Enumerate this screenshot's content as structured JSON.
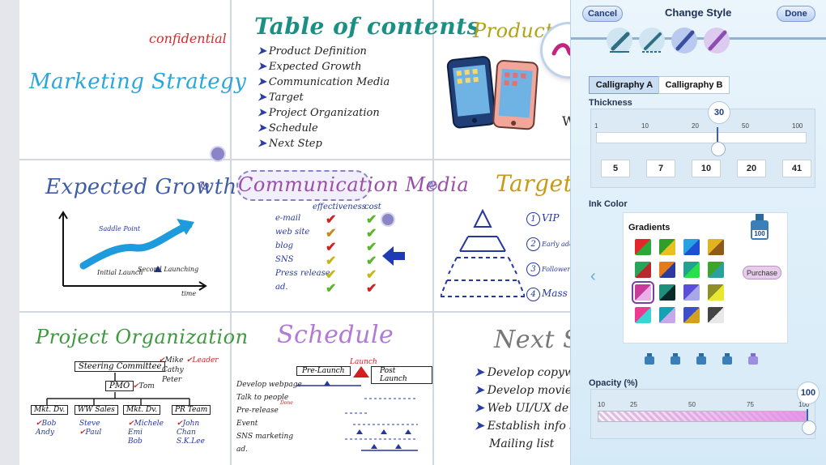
{
  "slides": {
    "marketing": {
      "confidential": "confidential",
      "title": "Marketing Strategy"
    },
    "toc": {
      "title": "Table of contents",
      "items": [
        "Product Definition",
        "Expected Growth",
        "Communication Media",
        "Target",
        "Project Organization",
        "Schedule",
        "Next Step"
      ]
    },
    "product": {
      "title": "Product D",
      "side_letter": "W"
    },
    "growth": {
      "title": "Expected Growth",
      "saddle": "Saddle Point",
      "initial": "Initial Launch",
      "second": "Second Launching",
      "time": "time"
    },
    "comm": {
      "title": "Communication Media",
      "col1": "effectiveness",
      "col2": "cost",
      "rows": [
        "e-mail",
        "web site",
        "blog",
        "SNS",
        "Press release",
        "ad."
      ]
    },
    "target": {
      "title": "Target",
      "items": [
        {
          "num": "1",
          "label": "VIP"
        },
        {
          "num": "2",
          "label": "Early adopter"
        },
        {
          "num": "3",
          "label": "Follower"
        },
        {
          "num": "4",
          "label": "Mass"
        }
      ]
    },
    "project": {
      "title": "Project Organization",
      "steering": "Steering Committee",
      "pmo": "PMO",
      "tom": "Tom",
      "mike": "Mike",
      "cathy": "Cathy",
      "peter": "Peter",
      "leader": "Leader",
      "teams": [
        "Mkt. Dv.",
        "WW Sales",
        "Mkt. Dv.",
        "PR Team"
      ],
      "members": [
        [
          "Bob",
          "Andy"
        ],
        [
          "Steve",
          "Paul"
        ],
        [
          "Michele",
          "Emi",
          "Bob"
        ],
        [
          "John",
          "Chan",
          "S.K.Lee"
        ]
      ]
    },
    "schedule": {
      "title": "Schedule",
      "launch": "Launch",
      "pre": "Pre-Launch",
      "post": "Post Launch",
      "tasks": [
        "Develop webpage",
        "Talk to people",
        "Pre-release",
        "Event",
        "SNS marketing",
        "ad."
      ],
      "note": "Done"
    },
    "next": {
      "title": "Next St",
      "items": [
        "Develop copywri",
        "Develop movie s",
        "Web UI/UX de",
        "Establish info s",
        "Mailing list"
      ]
    }
  },
  "panel": {
    "cancel": "Cancel",
    "title": "Change Style",
    "done": "Done",
    "pen_icons": [
      "pen-1-icon",
      "pen-2-icon",
      "pen-3-icon",
      "brush-icon"
    ],
    "tabs": [
      "Calligraphy A",
      "Calligraphy B"
    ],
    "thickness_label": "Thickness",
    "thickness_value": "30",
    "thickness_ticks": [
      "1",
      "10",
      "20",
      "50",
      "100"
    ],
    "thickness_presets": [
      "5",
      "7",
      "10",
      "20",
      "41"
    ],
    "ink_color_label": "Ink Color",
    "gradients_label": "Gradients",
    "ink_bottle_value": "100",
    "purchase": "Purchase",
    "opacity_label": "Opacity (%)",
    "opacity_value": "100",
    "opacity_ticks": [
      "10",
      "25",
      "50",
      "75",
      "100"
    ],
    "colors": {
      "accent": "#3a5cc7",
      "panel_bg": "#e3f1fb",
      "selected_swatch": "#7b3fa3",
      "opacity_fill": "#e58fe6"
    }
  }
}
